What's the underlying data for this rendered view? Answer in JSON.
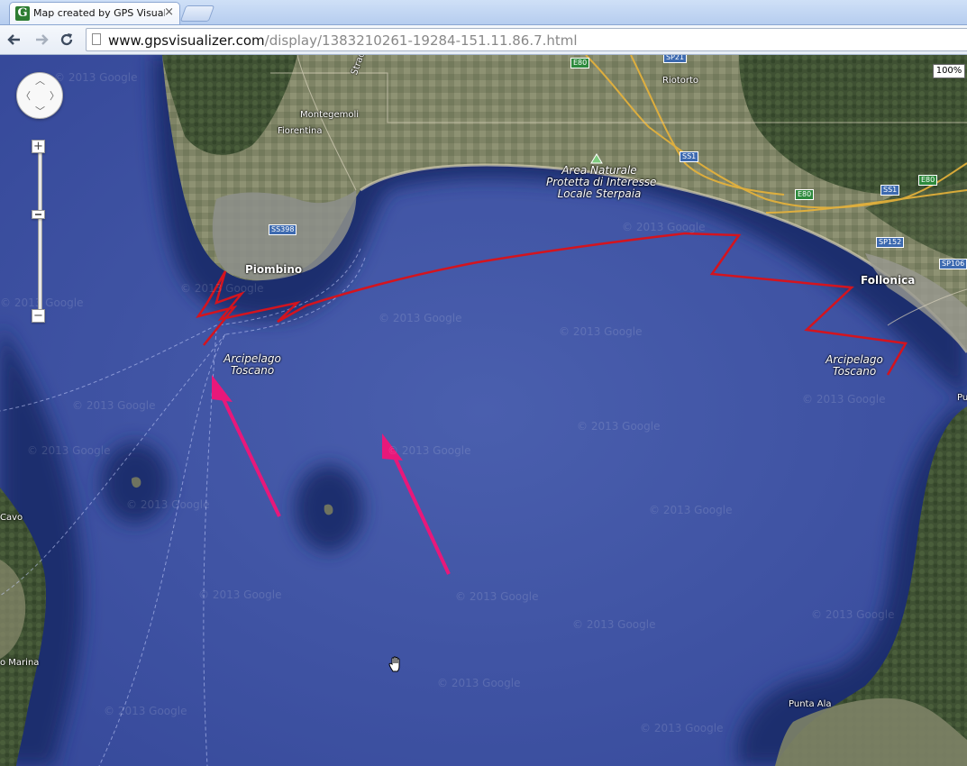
{
  "browser": {
    "tab_title": "Map created by GPS Visualizer",
    "tab_close": "×",
    "favicon_letter": "G",
    "url_host": "www.gpsvisualizer.com",
    "url_path": "/display/1383210261-19284-151.11.86.7.html",
    "back_icon": "back-arrow-icon",
    "forward_icon": "forward-arrow-icon",
    "reload_icon": "reload-icon"
  },
  "map": {
    "zoom_level": "100%",
    "zoom_in_label": "+",
    "zoom_out_label": "−",
    "zoom_mid_label": "−",
    "watermark_text": "© 2013 Google",
    "places": [
      {
        "key": "piombino",
        "name": "Piombino"
      },
      {
        "key": "follonica",
        "name": "Follonica"
      },
      {
        "key": "riotorto",
        "name": "Riotorto"
      },
      {
        "key": "montegemoli",
        "name": "Montegemoli"
      },
      {
        "key": "fiorentina",
        "name": "Fiorentina"
      },
      {
        "key": "punta_ala",
        "name": "Punta Ala"
      },
      {
        "key": "cavo",
        "name": "Cavo"
      },
      {
        "key": "marina",
        "name": "o Marina"
      },
      {
        "key": "strada",
        "name": "Strada Stat"
      },
      {
        "key": "puc",
        "name": "Pu"
      }
    ],
    "area_label": [
      "Area Naturale",
      "Protetta di Interesse",
      "Locale Sterpaia"
    ],
    "archipelago_label": [
      "Arcipelago",
      "Toscano"
    ],
    "roads": [
      "E80",
      "SP21",
      "SS1",
      "SS1",
      "E80",
      "E80",
      "SS398",
      "SP152",
      "SP106"
    ],
    "colors": {
      "sea": "#3e54a3",
      "track": "#d4141e",
      "arrow": "#e8187a",
      "land": "#4a5a3a"
    }
  }
}
